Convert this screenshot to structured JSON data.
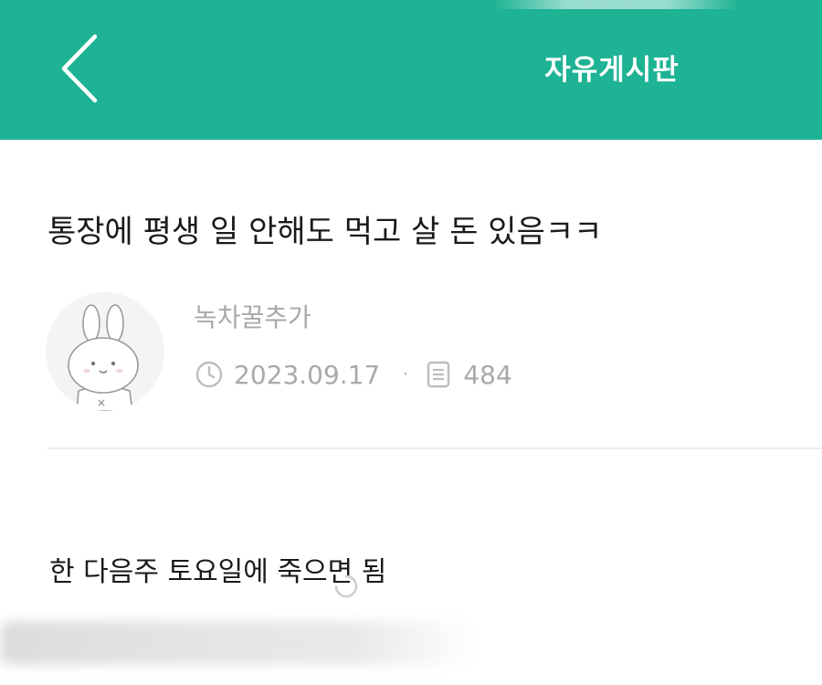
{
  "header": {
    "title": "자유게시판",
    "back_icon": "chevron-left-icon",
    "background_color": "#1db394",
    "text_color": "#ffffff"
  },
  "post": {
    "title": "통장에 평생 일 안해도 먹고 살 돈 있음ㅋㅋ",
    "author": {
      "name": "녹차꿀추가",
      "avatar_icon": "bunny-avatar"
    },
    "date": "2023.09.17",
    "date_icon": "clock-icon",
    "separator": "·",
    "views": "484",
    "views_icon": "document-icon",
    "body": "한 다음주 토요일에 죽으면 됨"
  },
  "colors": {
    "meta_text": "#a9a9a9",
    "title_text": "#1a1a1a",
    "divider": "#ececec"
  }
}
